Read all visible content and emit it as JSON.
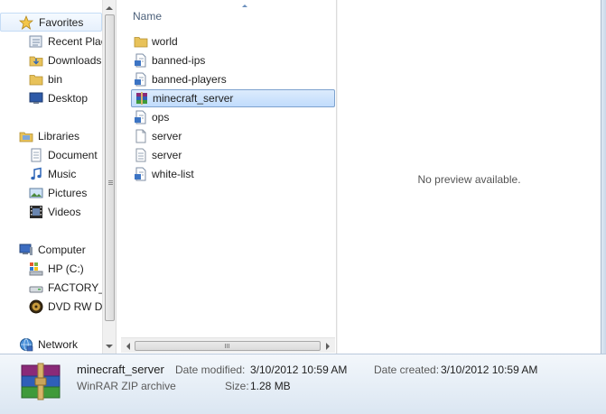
{
  "nav": {
    "favorites": {
      "label": "Favorites",
      "items": [
        {
          "label": "Recent Plac",
          "icon": "recent-places-icon"
        },
        {
          "label": "Downloads",
          "icon": "downloads-folder-icon"
        },
        {
          "label": "bin",
          "icon": "folder-icon"
        },
        {
          "label": "Desktop",
          "icon": "desktop-icon"
        }
      ]
    },
    "libraries": {
      "label": "Libraries",
      "items": [
        {
          "label": "Document",
          "icon": "documents-icon"
        },
        {
          "label": "Music",
          "icon": "music-icon"
        },
        {
          "label": "Pictures",
          "icon": "pictures-icon"
        },
        {
          "label": "Videos",
          "icon": "videos-icon"
        }
      ]
    },
    "computer": {
      "label": "Computer",
      "items": [
        {
          "label": "HP (C:)",
          "icon": "hard-drive-icon"
        },
        {
          "label": "FACTORY_",
          "icon": "drive-icon"
        },
        {
          "label": "DVD RW Dr",
          "icon": "dvd-drive-icon"
        }
      ]
    },
    "network": {
      "label": "Network"
    }
  },
  "file_list": {
    "column_header": "Name",
    "files": [
      {
        "name": "world",
        "icon": "folder-icon",
        "selected": false
      },
      {
        "name": "banned-ips",
        "icon": "text-document-icon",
        "selected": false
      },
      {
        "name": "banned-players",
        "icon": "text-document-icon",
        "selected": false
      },
      {
        "name": "minecraft_server",
        "icon": "winrar-archive-icon",
        "selected": true
      },
      {
        "name": "ops",
        "icon": "text-document-icon",
        "selected": false
      },
      {
        "name": "server",
        "icon": "generic-file-icon",
        "selected": false
      },
      {
        "name": "server",
        "icon": "properties-file-icon",
        "selected": false
      },
      {
        "name": "white-list",
        "icon": "text-document-icon",
        "selected": false
      }
    ]
  },
  "preview": {
    "message": "No preview available."
  },
  "details": {
    "name": "minecraft_server",
    "type": "WinRAR ZIP archive",
    "date_modified_label": "Date modified:",
    "date_modified": "3/10/2012 10:59 AM",
    "size_label": "Size:",
    "size": "1.28 MB",
    "date_created_label": "Date created:",
    "date_created": "3/10/2012 10:59 AM"
  },
  "colors": {
    "selection_bg": "#c1dcfc",
    "selection_border": "#7da2ce",
    "folder": "#e8c25a"
  }
}
